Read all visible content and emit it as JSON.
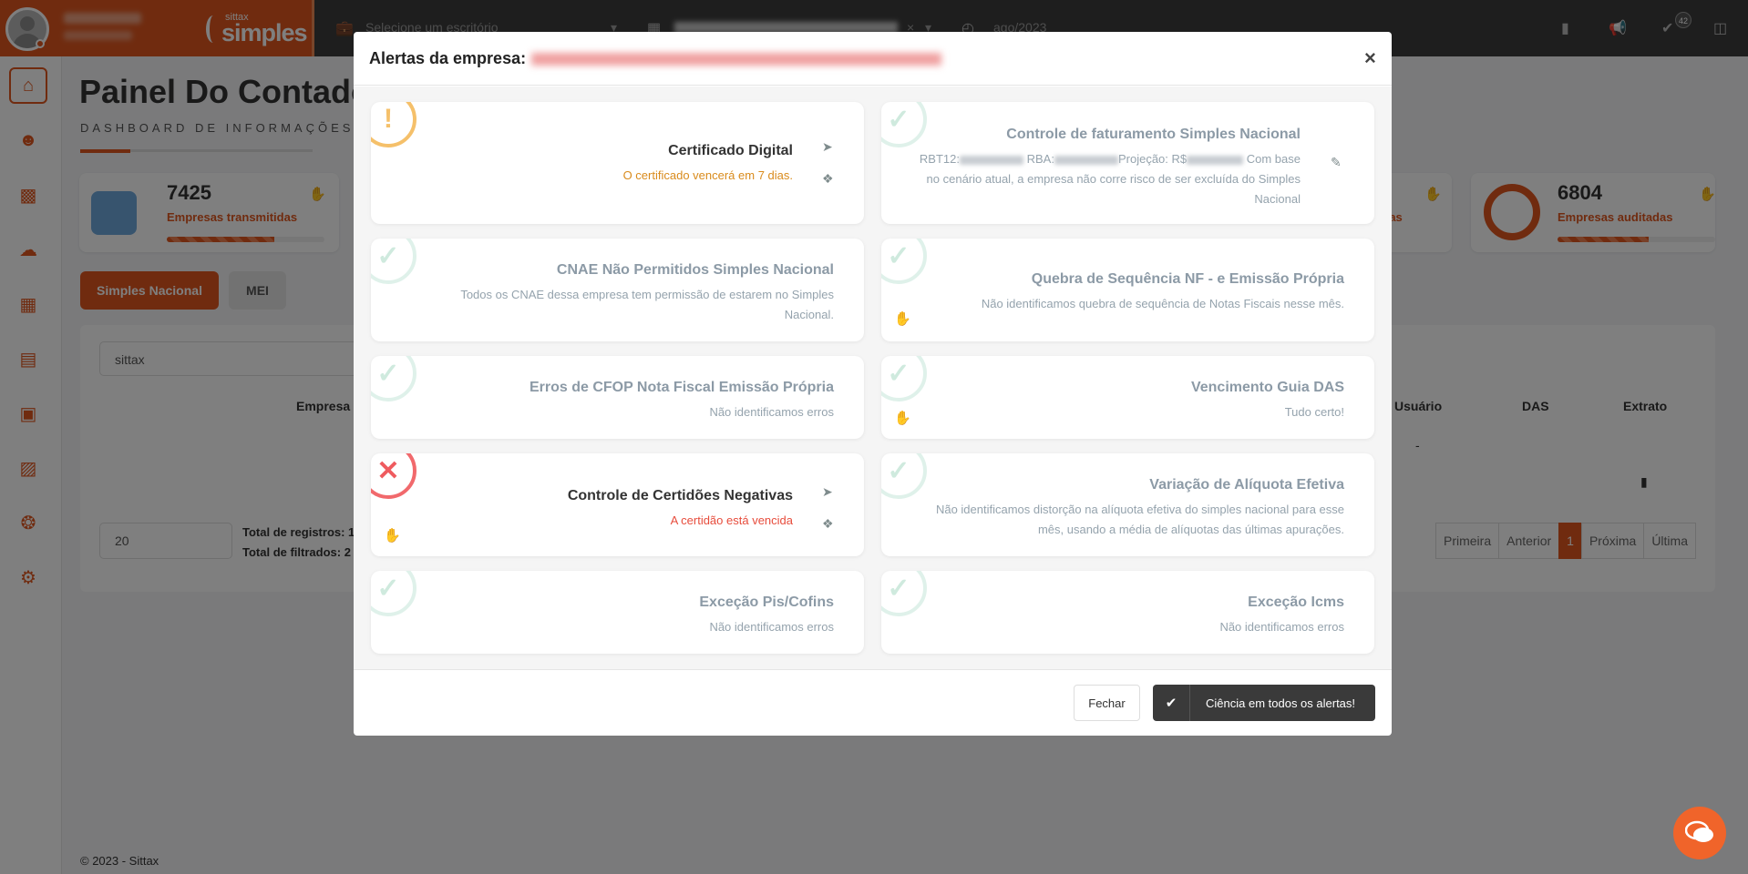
{
  "topbar": {
    "brand_small": "sittax",
    "brand_big": "simples",
    "office_placeholder": "Selecione um escritório",
    "period": "ago/2023",
    "notification_count": "42"
  },
  "page": {
    "title": "Painel Do Contador",
    "subtitle": "DASHBOARD DE INFORMAÇÕES D",
    "stats": [
      {
        "value": "7425",
        "label": "Empresas transmitidas",
        "progress_pct": 68
      },
      {
        "value": "6804",
        "label": "Empresas auditadas",
        "progress_pct": 58
      }
    ],
    "partial_stat_label": "tas",
    "tabs": [
      "Simples Nacional",
      "MEI"
    ],
    "search_value": "sittax",
    "table_headers": {
      "empresa": "Empresa",
      "usuario": "Usuário",
      "das": "DAS",
      "extrato": "Extrato"
    },
    "row_dash": "-",
    "page_size": "20",
    "total_registros_label": "Total de registros: 1",
    "total_filtrados_label": "Total de filtrados: 2",
    "pager": [
      "Primeira",
      "Anterior",
      "1",
      "Próxima",
      "Última"
    ],
    "footer": "© 2023 - Sittax"
  },
  "modal": {
    "title": "Alertas da empresa:",
    "close_symbol": "×",
    "alerts": [
      {
        "title": "Certificado Digital",
        "description": "O certificado vencerá em 7 dias.",
        "status": "warning",
        "desc_color": "#d98b1c"
      },
      {
        "title": "Controle de faturamento Simples Nacional",
        "rbt_label": "RBT12:",
        "rba_label": "RBA:",
        "projection_label": "Projeção: R$",
        "description_tail": "Com base",
        "description_rest": "no cenário atual, a empresa não corre risco de ser excluída do Simples Nacional",
        "status": "ok"
      },
      {
        "title": "CNAE Não Permitidos Simples Nacional",
        "description": "Todos os CNAE dessa empresa tem permissão de estarem no Simples Nacional.",
        "status": "ok"
      },
      {
        "title": "Quebra de Sequência NF - e Emissão Própria",
        "description": "Não identificamos quebra de sequência de Notas Fiscais nesse mês.",
        "status": "ok"
      },
      {
        "title": "Erros de CFOP Nota Fiscal Emissão Própria",
        "description": "Não identificamos erros",
        "status": "ok"
      },
      {
        "title": "Vencimento Guia DAS",
        "description": "Tudo certo!",
        "status": "ok"
      },
      {
        "title": "Controle de Certidões Negativas",
        "description": "A certidão está vencida",
        "status": "error",
        "desc_color": "#e74c3c"
      },
      {
        "title": "Variação de Alíquota Efetiva",
        "description": "Não identificamos distorção na alíquota efetiva do simples nacional para esse mês, usando a média de alíquotas das últimas apurações.",
        "status": "ok"
      },
      {
        "title": "Exceção Pis/Cofins",
        "description": "Não identificamos erros",
        "status": "ok"
      },
      {
        "title": "Exceção Icms",
        "description": "Não identificamos erros",
        "status": "ok"
      }
    ],
    "buttons": {
      "close": "Fechar",
      "acknowledge": "Ciência em todos os alertas!"
    }
  },
  "colors": {
    "accent": "#e0571f",
    "topbar": "#3d3d3d",
    "warning": "#f5c06a",
    "error": "#ef5b5f",
    "ok": "#dff1ea"
  }
}
